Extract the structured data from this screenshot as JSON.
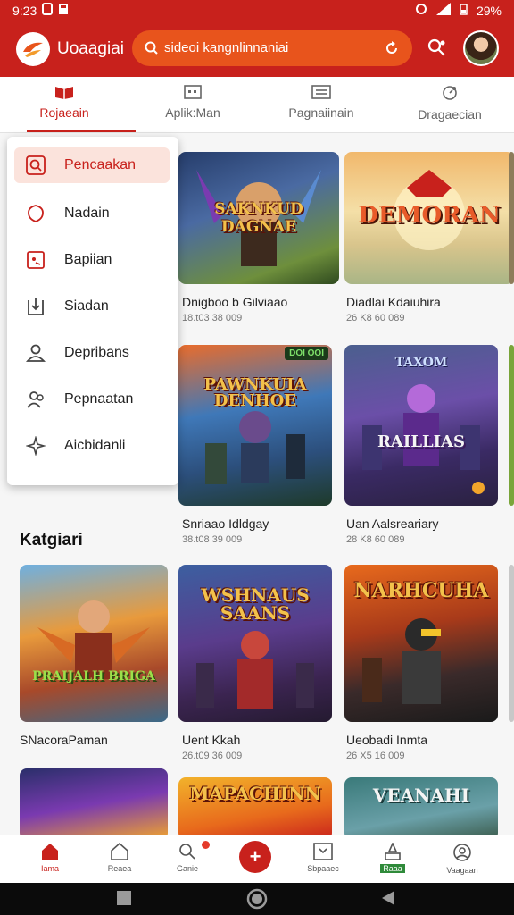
{
  "status_bar": {
    "time": "9:23",
    "battery": "29%"
  },
  "app": {
    "title": "Uoaagiai"
  },
  "search": {
    "text": "sideoi kangnlinnaniai"
  },
  "tabs": [
    {
      "label": "Rojaeain"
    },
    {
      "label": "Aplik:Man"
    },
    {
      "label": "Pagnaiinain"
    },
    {
      "label": "Dragaecian"
    }
  ],
  "menu": {
    "items": [
      {
        "label": "Pencaakan"
      },
      {
        "label": "Nadain"
      },
      {
        "label": "Bapiian"
      },
      {
        "label": "Siadan"
      },
      {
        "label": "Depribans"
      },
      {
        "label": "Pepnaatan"
      },
      {
        "label": "Aicbidanli"
      }
    ]
  },
  "featured": [
    {
      "art": "SAKNKUD DAGNAE",
      "title": "Dnigboo b Gilviaao",
      "sub": "18.t03 38 009"
    },
    {
      "art": "DEMORAN",
      "title": "Diadlai Kdaiuhira",
      "sub": "26 K8 60 089"
    }
  ],
  "row2": [
    {
      "badge": "DOI  OOI",
      "art": "PAWNKUIA DENHOE",
      "title": "Snriaao Idldgay",
      "sub": "38.t08 39 009"
    },
    {
      "art_top": "TAXOM",
      "art": "RAILLIAS",
      "title": "Uan Aalsreariary",
      "sub": "28 K8 60 089"
    }
  ],
  "section": {
    "title": "Katgiari"
  },
  "row3": [
    {
      "art": "PRAIJALH BRIGA",
      "title": "SNacoraPaman",
      "sub": ""
    },
    {
      "art": "WSHNAUS SAANS",
      "title": "Uent Kkah",
      "sub": "26.t09 36 009"
    },
    {
      "art": "NARHCUHA",
      "title": "Ueobadi Inmta",
      "sub": "26 X5 16 009"
    }
  ],
  "row4": [
    {
      "art": ""
    },
    {
      "art": "MAPACHINN"
    },
    {
      "art": "VEANAHI"
    }
  ],
  "bottom_nav": [
    {
      "label": "Iama"
    },
    {
      "label": "Reaea"
    },
    {
      "label": "Ganie"
    },
    {
      "label": ""
    },
    {
      "label": "Sbpaaec"
    },
    {
      "label": "Raaa"
    },
    {
      "label": "Vaagaan"
    }
  ],
  "colors": {
    "brand": "#c8211c",
    "accent": "#e8541c"
  }
}
